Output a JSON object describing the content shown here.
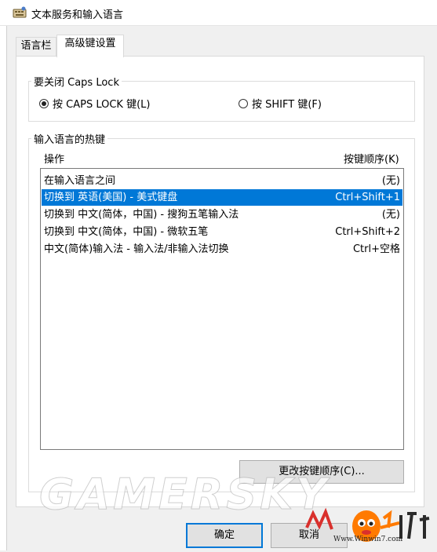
{
  "window": {
    "title": "文本服务和输入语言",
    "icon": "keyboard-settings-icon"
  },
  "tabs": [
    {
      "label": "语言栏",
      "active": false
    },
    {
      "label": "高级键设置",
      "active": true
    }
  ],
  "caps_lock": {
    "group_label": "要关闭 Caps Lock",
    "options": [
      {
        "label": "按 CAPS LOCK 键(L)",
        "selected": true
      },
      {
        "label": "按 SHIFT 键(F)",
        "selected": false
      }
    ]
  },
  "hotkeys": {
    "group_label": "输入语言的热键",
    "col_action": "操作",
    "col_keys": "按键顺序(K)",
    "rows": [
      {
        "action": "在输入语言之间",
        "keys": "(无)",
        "selected": false
      },
      {
        "action": "切换到 英语(美国) - 美式键盘",
        "keys": "Ctrl+Shift+1",
        "selected": true
      },
      {
        "action": "切换到 中文(简体，中国) - 搜狗五笔输入法",
        "keys": "(无)",
        "selected": false
      },
      {
        "action": "切换到 中文(简体，中国) - 微软五笔",
        "keys": "Ctrl+Shift+2",
        "selected": false
      },
      {
        "action": "中文(简体)输入法 - 输入法/非输入法切换",
        "keys": "Ctrl+空格",
        "selected": false
      }
    ],
    "change_button": "更改按键顺序(C)..."
  },
  "buttons": {
    "ok": "确定",
    "cancel": "取消"
  },
  "watermark": "GAMERSKY",
  "logo": {
    "url": "Www.Winwin7.com",
    "text_left": "Wi",
    "text_right": "游"
  },
  "colors": {
    "selection": "#0078d7",
    "accent_orange": "#ff7a00"
  }
}
